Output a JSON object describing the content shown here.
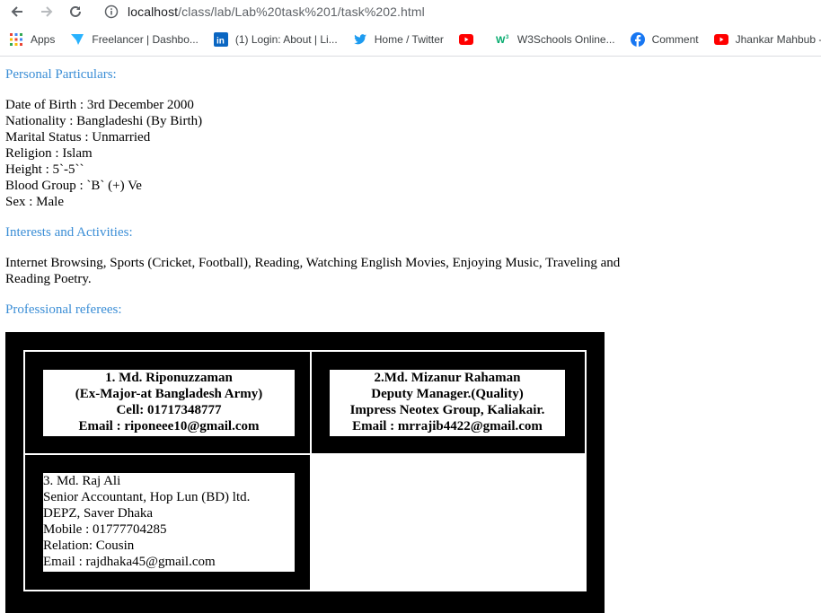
{
  "browser": {
    "url_host": "localhost",
    "url_path": "/class/lab/Lab%20task%201/task%202.html",
    "bookmarks": [
      {
        "label": "Apps",
        "icon": "apps-grid-icon"
      },
      {
        "label": "Freelancer | Dashbo...",
        "icon": "freelancer-icon"
      },
      {
        "label": "(1) Login: About | Li...",
        "icon": "linkedin-icon"
      },
      {
        "label": "Home / Twitter",
        "icon": "twitter-icon"
      },
      {
        "label": "",
        "icon": "youtube-icon"
      },
      {
        "label": "W3Schools Online...",
        "icon": "w3schools-icon"
      },
      {
        "label": "Comment",
        "icon": "facebook-icon"
      },
      {
        "label": "Jhankar Mahbub -...",
        "icon": "youtube-icon"
      }
    ],
    "colors": {
      "youtube": "#ff0000",
      "twitter": "#1d9bf0",
      "linkedin": "#0a66c2",
      "facebook": "#1877f2",
      "freelancer": "#29b2fe",
      "w3schools": "#04aa6d"
    }
  },
  "sections": {
    "personal_title": "Personal Particulars:",
    "personal": [
      "Date of Birth : 3rd December 2000",
      "Nationality : Bangladeshi (By Birth)",
      "Marital Status : Unmarried",
      "Religion : Islam",
      "Height : 5`-5``",
      "Blood Group : `B` (+) Ve",
      "Sex : Male"
    ],
    "interests_title": "Interests and Activities:",
    "interests": "Internet Browsing, Sports (Cricket, Football), Reading, Watching English Movies, Enjoying Music, Traveling and Reading Poetry.",
    "referees_title": "Professional referees:",
    "heading_color": "#3b8ed6"
  },
  "referees": [
    {
      "lines": [
        "1. Md. Riponuzzaman",
        "(Ex-Major-at Bangladesh Army)",
        "Cell: 01717348777",
        "Email : riponeee10@gmail.com"
      ]
    },
    {
      "lines": [
        "2.Md. Mizanur Rahaman",
        "Deputy Manager.(Quality)",
        "Impress Neotex Group, Kaliakair.",
        "Email : mrrajib4422@gmail.com"
      ]
    },
    {
      "lines": [
        "3. Md. Raj Ali",
        "Senior Accountant, Hop Lun (BD) ltd.",
        "DEPZ, Saver Dhaka",
        "Mobile : 01777704285",
        "Relation: Cousin",
        "Email : rajdhaka45@gmail.com"
      ]
    }
  ]
}
